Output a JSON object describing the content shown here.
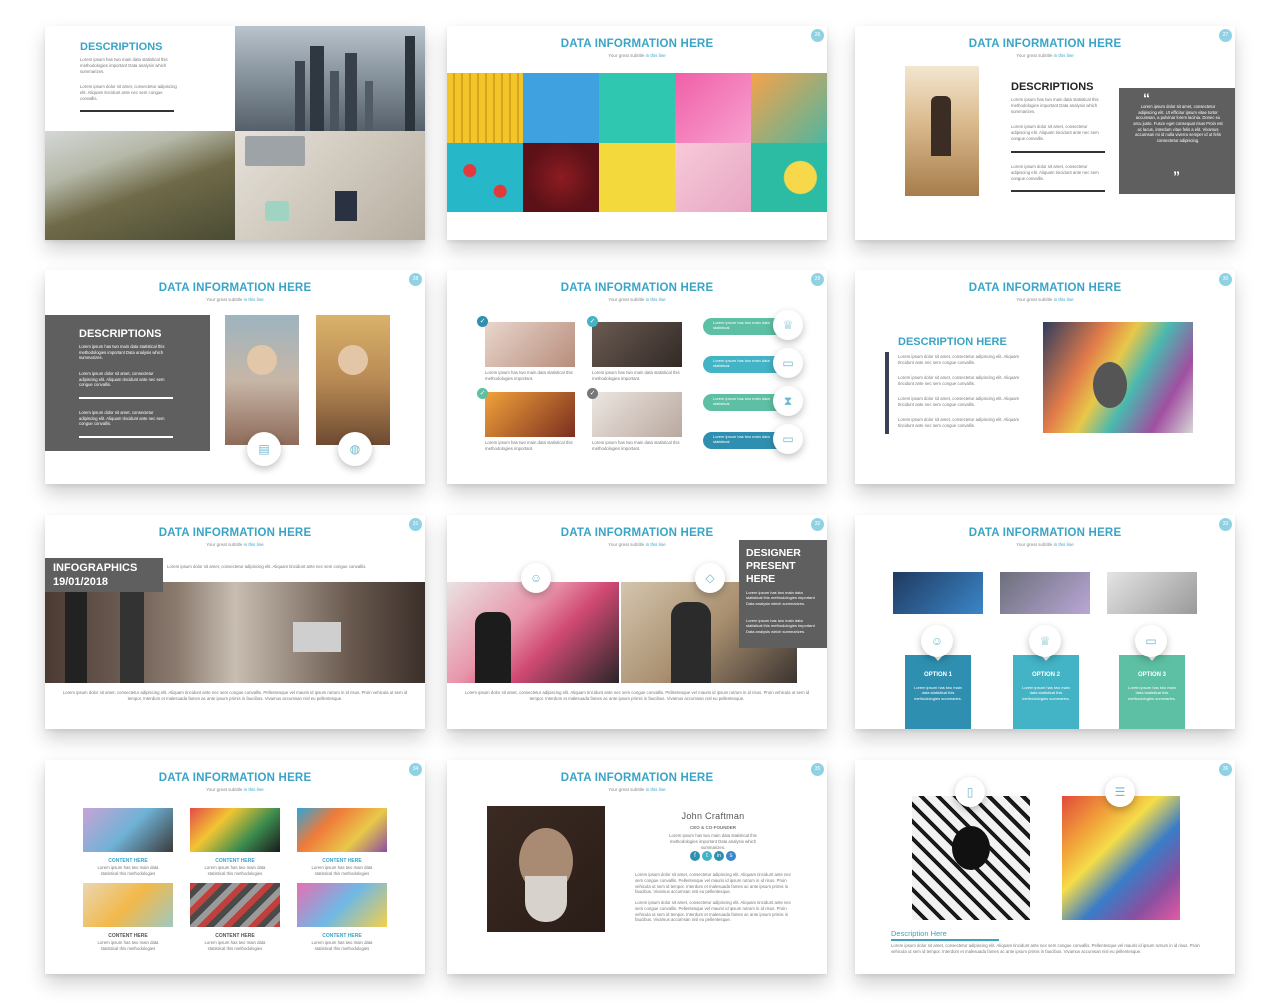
{
  "common": {
    "data_title": "DATA INFORMATION HERE",
    "subtitle_a": "Your great subtitle",
    "subtitle_b": "in this line",
    "lorem_short": "Lorem ipsum has two main data statistical this methodologies important Data analysis which summarizes.",
    "lorem_block": "Lorem ipsum dolor sit amet, consectetur adipiscing elit. Aliquam tincidunt ante nec sem congue convallis.",
    "lorem_long": "Lorem ipsum dolor sit amet, consectetur adipiscing elit. Aliquam tincidunt ante nec sem congue convallis. Pellentesque vel mauris id ipsum rutrum in id risus. Proin vehicula ut sem id tempor. Interdum et malesuada fames ac ante ipsum primis in faucibus. Vivamus accumsan nisl eu pellentesque.",
    "lorem_small": "Lorem ipsum has two main data statistical this methodologies important."
  },
  "slide1": {
    "heading": "DESCRIPTIONS"
  },
  "slide2": {
    "number": "26"
  },
  "slide3": {
    "number": "27",
    "heading": "DESCRIPTIONS",
    "quote_open": "“",
    "quote_close": "”",
    "quote": "Lorem ipsum dolor sit amet, consectetur adipiscing elit. Ut efficitur ipsum vitae tortor accumsan, a pulvinar lorem lacinia. Donec eu arcu justo. Fusce eget consequat risus Proin est ac lacus, interdum vitae felis a elit. Vivamus accumsan mi id nulla viverra semper id ut felis consectetur adipiscing."
  },
  "slide4": {
    "number": "28",
    "heading": "DESCRIPTIONS"
  },
  "slide5": {
    "number": "29",
    "pills": [
      "Lorem ipsum has two main data statistical",
      "Lorem ipsum has two main data statistical",
      "Lorem ipsum has two main data statistical",
      "Lorem ipsum has two main data statistical"
    ]
  },
  "slide6": {
    "number": "30",
    "heading": "DESCRIPTION HERE"
  },
  "slide7": {
    "number": "31",
    "heading_line1": "INFOGRAPHICS",
    "heading_line2": "19/01/2018"
  },
  "slide8": {
    "number": "32",
    "heading_line1": "DESIGNER",
    "heading_line2": "PRESENT",
    "heading_line3": "HERE"
  },
  "slide9": {
    "number": "33",
    "options": [
      {
        "label": "OPTION 1",
        "color": "#2f8fb0"
      },
      {
        "label": "OPTION 2",
        "color": "#43b3c6"
      },
      {
        "label": "OPTION 3",
        "color": "#5dbfa3"
      }
    ],
    "option_text": "Lorem ipsum has two main data statistical this methodologies summaries."
  },
  "slide10": {
    "number": "34",
    "items": [
      "CONTENT HERE",
      "CONTENT HERE",
      "CONTENT HERE",
      "CONTENT HERE",
      "CONTENT HERE",
      "CONTENT HERE"
    ],
    "item_text": "Lorem ipsum has two main data statistical this methodologies"
  },
  "slide11": {
    "number": "35",
    "name": "John Craftman",
    "role": "CEO & CO-FOUNDER"
  },
  "slide12": {
    "number": "36",
    "heading": "Description Here"
  }
}
